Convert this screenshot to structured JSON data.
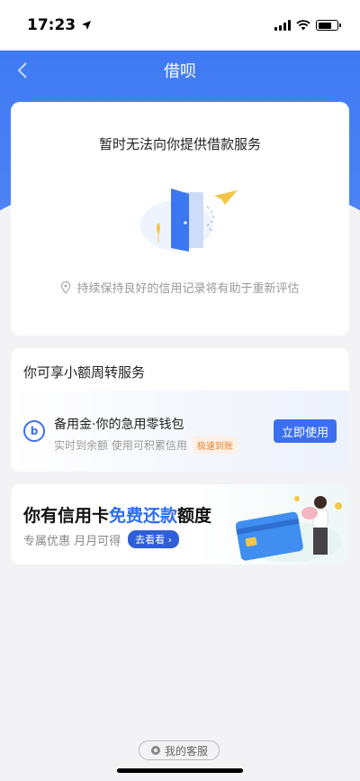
{
  "status_bar": {
    "time": "17:23"
  },
  "nav": {
    "title": "借呗"
  },
  "notice_card": {
    "title": "暂时无法向你提供借款服务",
    "hint": "持续保持良好的信用记录将有助于重新评估"
  },
  "service_card": {
    "section_title": "你可享小额周转服务",
    "product_name": "备用金·你的急用零钱包",
    "product_desc": "实时到余额 使用可积累信用",
    "tag": "极速到账",
    "button_label": "立即使用"
  },
  "promo_card": {
    "title_prefix": "你有信用卡",
    "title_highlight": "免费还款",
    "title_suffix": "额度",
    "subtitle": "专属优惠 月月可得",
    "button_label": "去看看"
  },
  "footer": {
    "service_label": "我的客服"
  },
  "colors": {
    "brand_blue": "#3c77f2",
    "tag_orange": "#e2843a"
  }
}
